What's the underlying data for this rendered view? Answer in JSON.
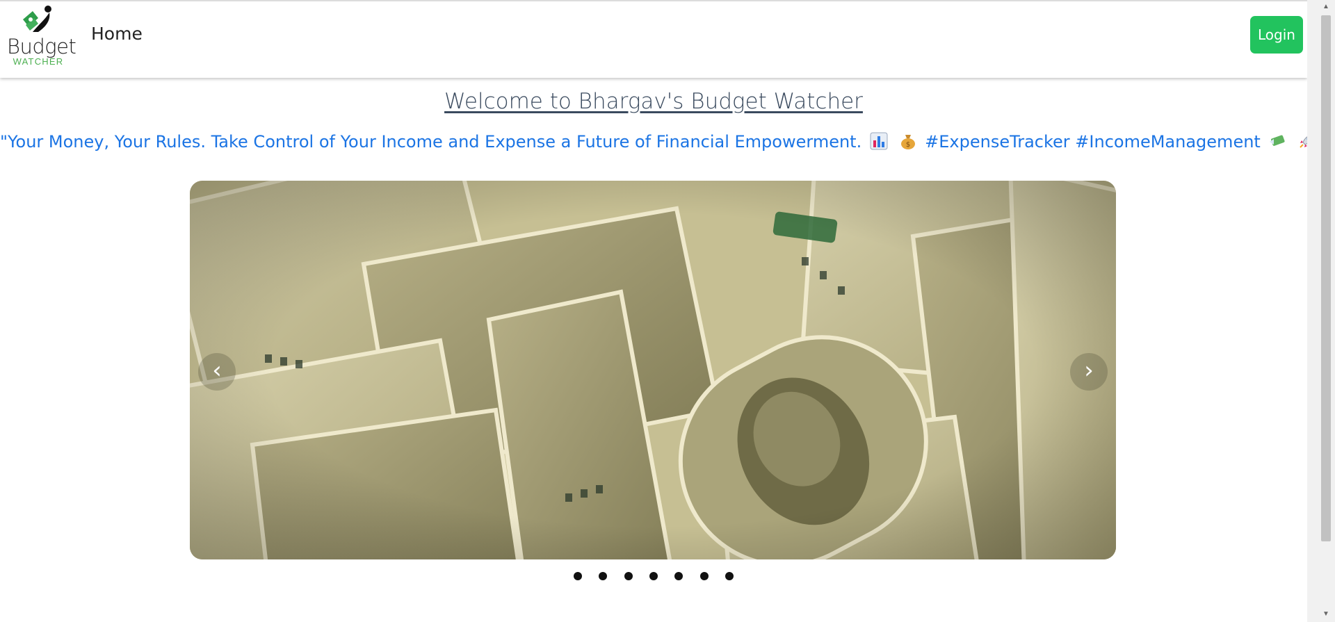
{
  "brand": {
    "name": "Budget",
    "sub": "WATCHER"
  },
  "nav": {
    "home": "Home",
    "login": "Login"
  },
  "hero": {
    "welcome": "Welcome to Bhargav's Budget Watcher",
    "tagline_start": "\"Your Money, Your Rules. Take Control of Your Income and Expense a Future of Financial Empowerment.",
    "tagline_tags": "#ExpenseTracker #IncomeManagement",
    "tagline_end": "\"",
    "icons": [
      "bar-chart-icon",
      "money-bag-icon",
      "money-with-wings-icon",
      "rocket-icon"
    ]
  },
  "carousel": {
    "prev": "‹",
    "next": "›",
    "slide_count": 7,
    "active_slide": 1
  },
  "colors": {
    "accent": "#22c35e",
    "link": "#1b74e4",
    "title": "#3a4a5e"
  }
}
